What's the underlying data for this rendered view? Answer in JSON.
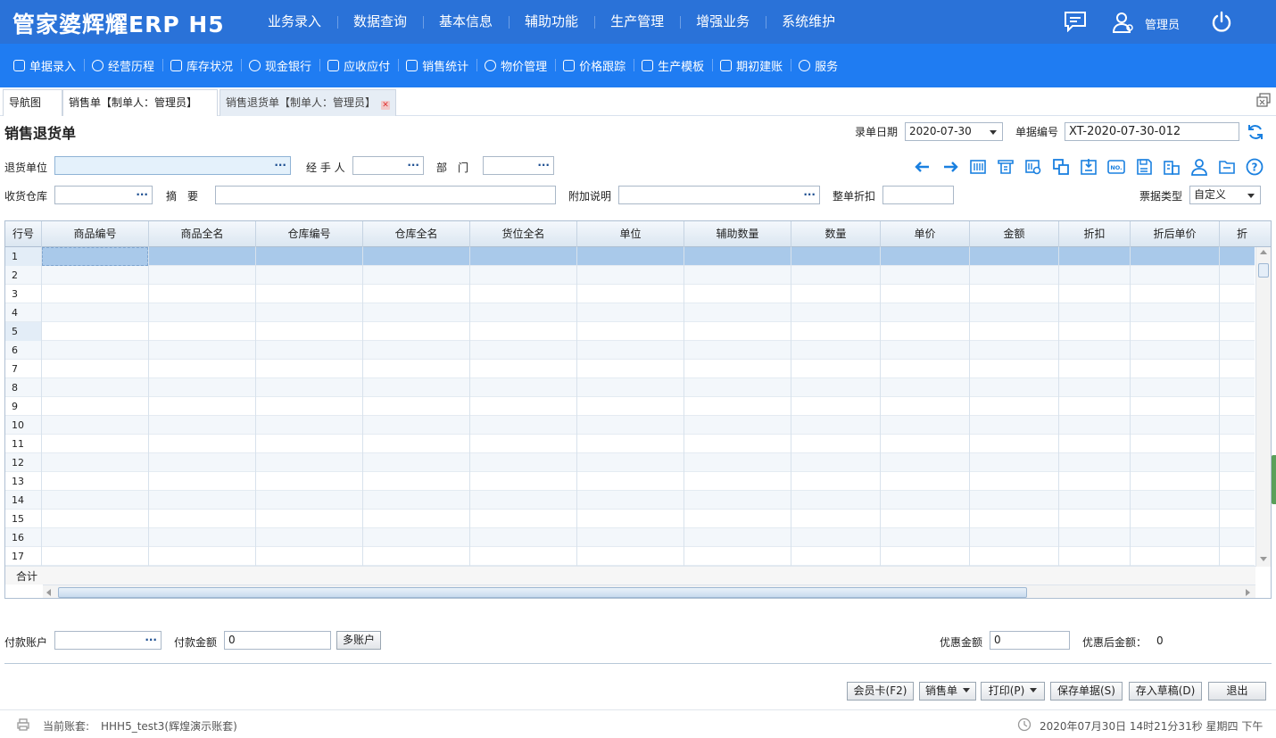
{
  "app": {
    "logo": "管家婆辉耀ERP H5"
  },
  "main_nav": [
    "业务录入",
    "数据查询",
    "基本信息",
    "辅助功能",
    "生产管理",
    "增强业务",
    "系统维护"
  ],
  "user": {
    "name": "管理员"
  },
  "sub_nav": [
    {
      "label": "单据录入",
      "icon": "edit-icon"
    },
    {
      "label": "经营历程",
      "icon": "check-circle-icon"
    },
    {
      "label": "库存状况",
      "icon": "box-icon"
    },
    {
      "label": "现金银行",
      "icon": "yuan-icon"
    },
    {
      "label": "应收应付",
      "icon": "transfer-icon"
    },
    {
      "label": "销售统计",
      "icon": "chart-icon"
    },
    {
      "label": "物价管理",
      "icon": "shield-icon"
    },
    {
      "label": "价格跟踪",
      "icon": "track-icon"
    },
    {
      "label": "生产模板",
      "icon": "template-icon"
    },
    {
      "label": "期初建账",
      "icon": "ledger-icon"
    },
    {
      "label": "服务",
      "icon": "help-icon"
    }
  ],
  "tabs": [
    {
      "label": "导航图"
    },
    {
      "label": "销售单【制单人：管理员】"
    },
    {
      "label": "销售退货单【制单人：管理员】"
    }
  ],
  "form": {
    "title": "销售退货单",
    "date_label": "录单日期",
    "date_value": "2020-07-30",
    "number_label": "单据编号",
    "number_value": "XT-2020-07-30-012",
    "return_unit_label": "退货单位",
    "handler_label": "经 手 人",
    "dept_label": "部　门",
    "warehouse_label": "收货仓库",
    "summary_label": "摘　要",
    "note_label": "附加说明",
    "discount_label": "整单折扣",
    "ticket_type_label": "票据类型",
    "ticket_type_value": "自定义"
  },
  "grid": {
    "columns": [
      "行号",
      "商品编号",
      "商品全名",
      "仓库编号",
      "仓库全名",
      "货位全名",
      "单位",
      "辅助数量",
      "数量",
      "单价",
      "金额",
      "折扣",
      "折后单价",
      "折后"
    ],
    "rows": [
      "1",
      "2",
      "3",
      "4",
      "5",
      "6",
      "7",
      "8",
      "9",
      "10",
      "11",
      "12",
      "13",
      "14",
      "15",
      "16",
      "17"
    ],
    "total_label": "合计"
  },
  "payment": {
    "account_label": "付款账户",
    "amount_label": "付款金额",
    "amount_value": "0",
    "multi_button": "多账户",
    "discount_label": "优惠金额",
    "discount_value": "0",
    "after_label": "优惠后金额：",
    "after_value": "0"
  },
  "actions": {
    "member": "会员卡(F2)",
    "sales": "销售单",
    "print": "打印(P)",
    "save": "保存单据(S)",
    "draft": "存入草稿(D)",
    "exit": "退出"
  },
  "footer": {
    "account_label": "当前账套:",
    "account_value": "HHH5_test3(辉煌演示账套)",
    "datetime": "2020年07月30日 14时21分31秒 星期四 下午"
  }
}
